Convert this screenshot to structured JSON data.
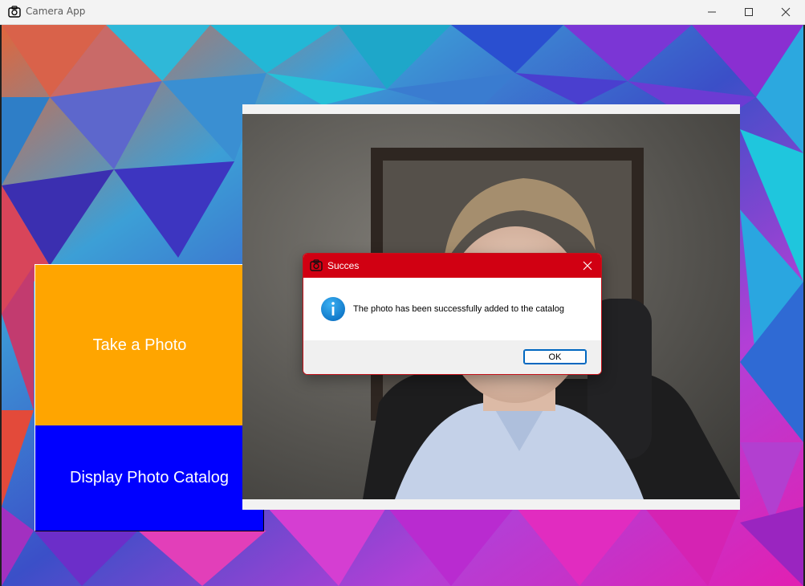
{
  "window": {
    "title": "Camera App"
  },
  "buttons": {
    "take_photo": "Take a Photo",
    "display_catalog": "Display Photo Catalog"
  },
  "dialog": {
    "title": "Succes",
    "message": "The photo has been successfully added to the catalog",
    "ok_label": "OK",
    "icon": "info-icon"
  },
  "colors": {
    "take_photo_bg": "#ffa500",
    "display_catalog_bg": "#0000ff",
    "dialog_titlebar": "#d10012"
  }
}
